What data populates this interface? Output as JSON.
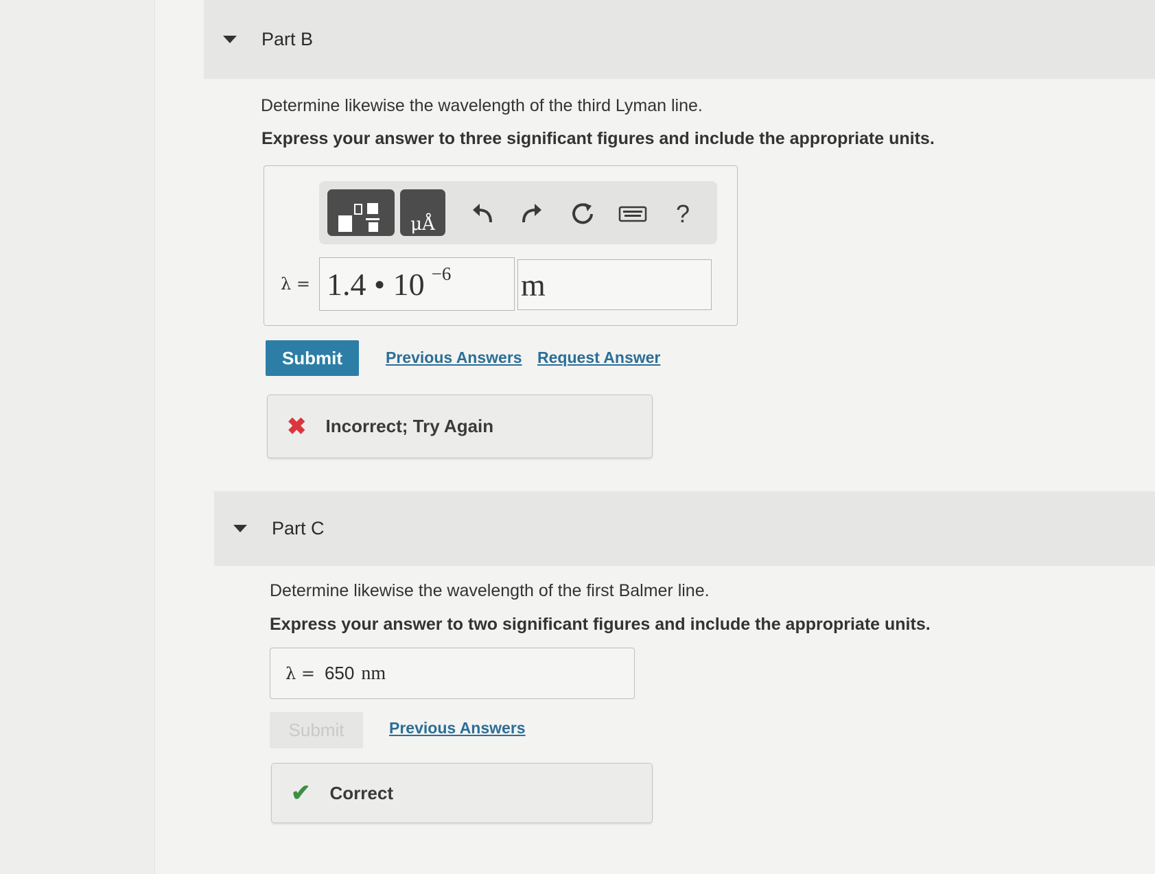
{
  "part_b": {
    "title": "Part B",
    "prompt": "Determine likewise the wavelength of the third Lyman line.",
    "instruction": "Express your answer to three significant figures and include the appropriate units.",
    "toolbar": {
      "templates_icon": "templates-icon",
      "units_label": "μÅ",
      "undo_icon": "undo-icon",
      "redo_icon": "redo-icon",
      "reset_icon": "reset-icon",
      "keyboard_icon": "keyboard-icon",
      "help_label": "?"
    },
    "variable": "λ =",
    "value_mantissa": "1.4 • 10",
    "value_exponent": "−6",
    "unit": "m",
    "submit_label": "Submit",
    "previous_answers": "Previous Answers",
    "request_answer": "Request Answer",
    "feedback": "Incorrect; Try Again",
    "feedback_icon": "✖"
  },
  "part_c": {
    "title": "Part C",
    "prompt": "Determine likewise the wavelength of the first Balmer line.",
    "instruction": "Express your answer to two significant figures and include the appropriate units.",
    "variable": "λ =",
    "answer_value": "650",
    "answer_unit": "nm",
    "submit_label": "Submit",
    "previous_answers": "Previous Answers",
    "feedback": "Correct",
    "feedback_icon": "✔"
  },
  "colors": {
    "submit": "#2c7ea6",
    "link": "#2b6e96",
    "incorrect": "#d9363e",
    "correct": "#3d8f41"
  }
}
